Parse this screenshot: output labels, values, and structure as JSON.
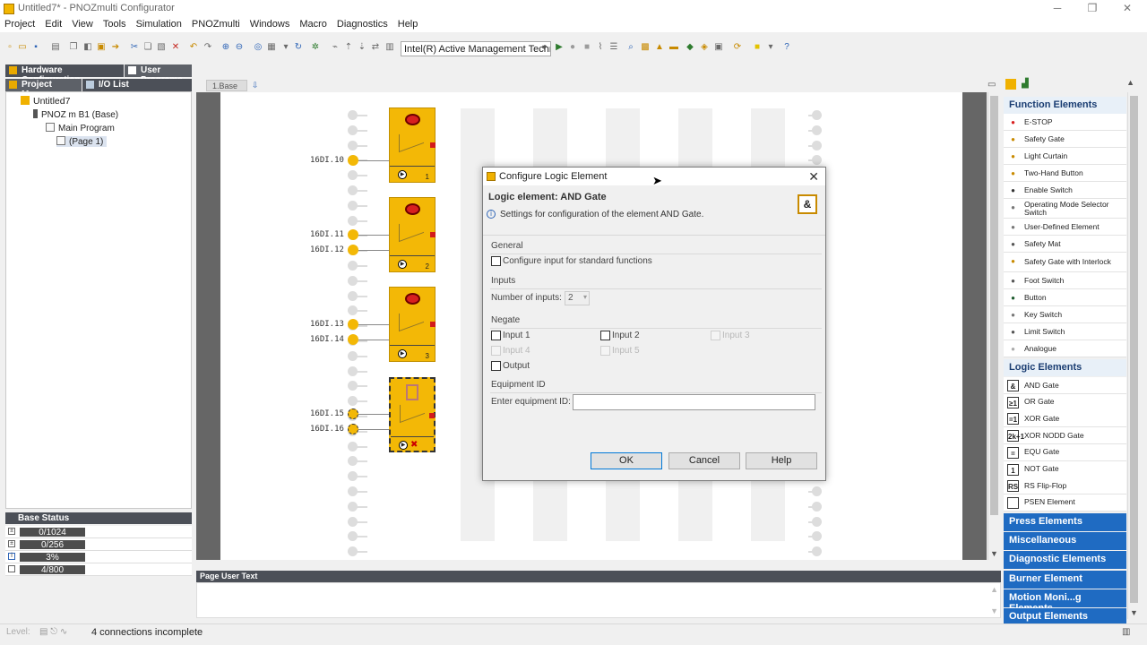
{
  "window": {
    "title": "Untitled7* - PNOZmulti Configurator",
    "minimize": "─",
    "maximize": "❐",
    "close": "✕"
  },
  "menu": [
    "Project",
    "Edit",
    "View",
    "Tools",
    "Simulation",
    "PNOZmulti",
    "Windows",
    "Macro",
    "Diagnostics",
    "Help"
  ],
  "toolbar": {
    "connection_combo": "Intel(R) Active Management Techn"
  },
  "left_panel": {
    "tabs": [
      "Hardware Configuration",
      "User Programs"
    ],
    "subtabs": [
      "Project Manager",
      "I/O List"
    ],
    "tree": [
      "Untitled7",
      "PNOZ m B1 (Base)",
      "Main Program",
      "(Page 1)"
    ]
  },
  "base_status": {
    "title": "Base Status",
    "rows": [
      "0/1024",
      "0/256",
      "3%",
      "4/800"
    ]
  },
  "editor": {
    "tab_label": "1.Base",
    "inputs": [
      "16DI.10",
      "16DI.11",
      "16DI.12",
      "16DI.13",
      "16DI.14",
      "16DI.15",
      "16DI.16"
    ],
    "block_numbers": [
      "1",
      "2",
      "3"
    ]
  },
  "page_user_text": {
    "title": "Page User Text"
  },
  "right_panel": {
    "function_elements_title": "Function Elements",
    "function_elements": [
      "E-STOP",
      "Safety Gate",
      "Light Curtain",
      "Two-Hand Button",
      "Enable Switch",
      "Operating Mode Selector Switch",
      "User-Defined Element",
      "Safety Mat",
      "Safety Gate with Interlock",
      "Foot Switch",
      "Button",
      "Key Switch",
      "Limit Switch",
      "Analogue"
    ],
    "logic_elements_title": "Logic Elements",
    "logic_elements": [
      "AND Gate",
      "OR Gate",
      "XOR Gate",
      "XOR NODD Gate",
      "EQU Gate",
      "NOT Gate",
      "RS Flip-Flop",
      "PSEN Element"
    ],
    "logic_icons": [
      "&",
      "≥1",
      "=1",
      "2k+1",
      "=",
      "1",
      "RS",
      ""
    ],
    "collapsed_sections": [
      "Press Elements",
      "Miscellaneous",
      "Diagnostic Elements",
      "Burner Element",
      "Motion Moni...g Elements",
      "Output Elements"
    ]
  },
  "status_bar": {
    "level_label": "Level:",
    "message": "4 connections incomplete"
  },
  "dialog": {
    "title": "Configure Logic Element",
    "element_label": "Logic element:  AND Gate",
    "info": "Settings for configuration of the element  AND Gate.",
    "logic_symbol": "&",
    "general_title": "General",
    "general_checkbox": "Configure input for standard functions",
    "inputs_title": "Inputs",
    "num_inputs_label": "Number of inputs:",
    "num_inputs_value": "2",
    "negate_title": "Negate",
    "negate_options": [
      "Input 1",
      "Input 2",
      "Input 3",
      "Input 4",
      "Input 5",
      "Output"
    ],
    "equipment_title": "Equipment ID",
    "equipment_label": "Enter equipment ID:",
    "equipment_value": "",
    "ok": "OK",
    "cancel": "Cancel",
    "help": "Help"
  },
  "colors": {
    "accent": "#1f6bc2",
    "block_yellow": "#f3b806",
    "dark_header": "#4c5058"
  }
}
